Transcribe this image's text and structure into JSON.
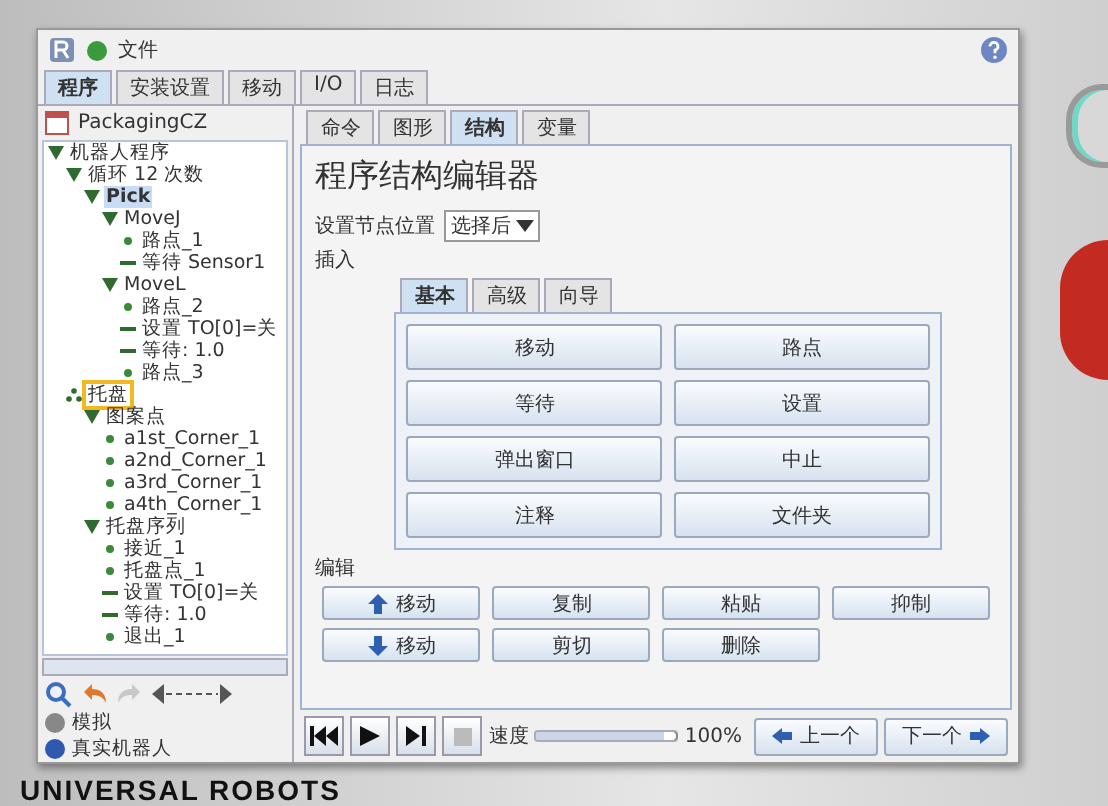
{
  "window": {
    "menu": "文件"
  },
  "main_tabs": [
    {
      "label": "程序",
      "selected": true
    },
    {
      "label": "安装设置",
      "selected": false
    },
    {
      "label": "移动",
      "selected": false
    },
    {
      "label": "I/O",
      "selected": false
    },
    {
      "label": "日志",
      "selected": false
    }
  ],
  "program_name": "PackagingCZ",
  "tree": [
    {
      "label": "机器人程序",
      "kind": "folder",
      "selected": false,
      "marked": false,
      "children": [
        {
          "label": "循环 12 次数",
          "kind": "folder",
          "selected": false,
          "marked": false,
          "children": [
            {
              "label": "Pick",
              "kind": "folder",
              "selected": true,
              "marked": false,
              "children": [
                {
                  "label": "MoveJ",
                  "kind": "folder",
                  "selected": false,
                  "marked": false,
                  "children": [
                    {
                      "label": "路点_1",
                      "kind": "waypoint",
                      "selected": false,
                      "marked": false
                    },
                    {
                      "label": "等待 Sensor1",
                      "kind": "command",
                      "selected": false,
                      "marked": false
                    }
                  ]
                },
                {
                  "label": "MoveL",
                  "kind": "folder",
                  "selected": false,
                  "marked": false,
                  "children": [
                    {
                      "label": "路点_2",
                      "kind": "waypoint",
                      "selected": false,
                      "marked": false
                    },
                    {
                      "label": "设置 TO[0]=关",
                      "kind": "command",
                      "selected": false,
                      "marked": false
                    },
                    {
                      "label": "等待: 1.0",
                      "kind": "command",
                      "selected": false,
                      "marked": false
                    },
                    {
                      "label": "路点_3",
                      "kind": "waypoint",
                      "selected": false,
                      "marked": false
                    }
                  ]
                }
              ]
            }
          ]
        },
        {
          "label": "托盘",
          "kind": "pallet",
          "selected": false,
          "marked": true,
          "children": [
            {
              "label": "图案点",
              "kind": "folder",
              "selected": false,
              "marked": false,
              "children": [
                {
                  "label": "a1st_Corner_1",
                  "kind": "waypoint",
                  "selected": false,
                  "marked": false
                },
                {
                  "label": "a2nd_Corner_1",
                  "kind": "waypoint",
                  "selected": false,
                  "marked": false
                },
                {
                  "label": "a3rd_Corner_1",
                  "kind": "waypoint",
                  "selected": false,
                  "marked": false
                },
                {
                  "label": "a4th_Corner_1",
                  "kind": "waypoint",
                  "selected": false,
                  "marked": false
                }
              ]
            },
            {
              "label": "托盘序列",
              "kind": "folder",
              "selected": false,
              "marked": false,
              "children": [
                {
                  "label": "接近_1",
                  "kind": "waypoint",
                  "selected": false,
                  "marked": false
                },
                {
                  "label": "托盘点_1",
                  "kind": "waypoint",
                  "selected": false,
                  "marked": false
                },
                {
                  "label": "设置 TO[0]=关",
                  "kind": "command",
                  "selected": false,
                  "marked": false
                },
                {
                  "label": "等待: 1.0",
                  "kind": "command",
                  "selected": false,
                  "marked": false
                },
                {
                  "label": "退出_1",
                  "kind": "waypoint",
                  "selected": false,
                  "marked": false
                }
              ]
            }
          ]
        }
      ]
    }
  ],
  "sub_tabs": [
    {
      "label": "命令",
      "selected": false
    },
    {
      "label": "图形",
      "selected": false
    },
    {
      "label": "结构",
      "selected": true
    },
    {
      "label": "变量",
      "selected": false
    }
  ],
  "editor_title": "程序结构编辑器",
  "node_position": {
    "label": "设置节点位置",
    "value": "选择后"
  },
  "insert_label": "插入",
  "insert_tabs": [
    {
      "label": "基本",
      "selected": true
    },
    {
      "label": "高级",
      "selected": false
    },
    {
      "label": "向导",
      "selected": false
    }
  ],
  "insert_buttons": [
    "移动",
    "路点",
    "等待",
    "设置",
    "弹出窗口",
    "中止",
    "注释",
    "文件夹"
  ],
  "edit_label": "编辑",
  "edit_buttons": [
    {
      "label": "移动",
      "kind": "up"
    },
    {
      "label": "复制",
      "kind": "plain"
    },
    {
      "label": "粘贴",
      "kind": "plain"
    },
    {
      "label": "抑制",
      "kind": "plain"
    },
    {
      "label": "移动",
      "kind": "down"
    },
    {
      "label": "剪切",
      "kind": "plain"
    },
    {
      "label": "删除",
      "kind": "plain"
    }
  ],
  "status": [
    "模拟",
    "真实机器人"
  ],
  "speed": {
    "label": "速度",
    "level": 1.0,
    "reading": "100%"
  },
  "nav": {
    "previous": "上一个",
    "next": "下一个"
  },
  "brand": "UNIVERSAL ROBOTS"
}
